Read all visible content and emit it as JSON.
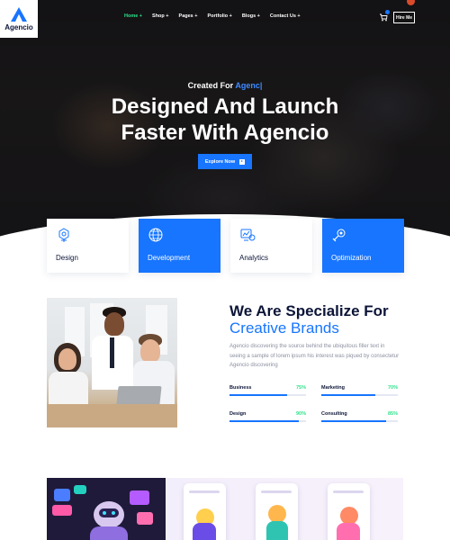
{
  "brand": {
    "name": "Agencio",
    "accent": "#1775ff",
    "nav_active": "#2ee38b"
  },
  "nav": {
    "items": [
      {
        "label": "Home +",
        "active": true
      },
      {
        "label": "Shop +",
        "active": false
      },
      {
        "label": "Pages +",
        "active": false
      },
      {
        "label": "Portfolio +",
        "active": false
      },
      {
        "label": "Blogs +",
        "active": false
      },
      {
        "label": "Contact Us +",
        "active": false
      }
    ],
    "cart_icon": "cart-icon",
    "hire_label": "Hire Me"
  },
  "hero": {
    "subtitle": "Created For ",
    "subtitle_accent": "Agenc|",
    "title_line1": "Designed And Launch",
    "title_line2": "Faster With Agencio",
    "button_label": "Explore Now",
    "button_icon": "arrow-right-icon"
  },
  "services": [
    {
      "label": "Design",
      "icon": "design-icon",
      "highlighted": false
    },
    {
      "label": "Development",
      "icon": "globe-icon",
      "highlighted": true
    },
    {
      "label": "Analytics",
      "icon": "analytics-icon",
      "highlighted": false
    },
    {
      "label": "Optimization",
      "icon": "optimization-icon",
      "highlighted": true
    }
  ],
  "about": {
    "title_line1": "We Are Specialize For",
    "title_line2": "Creative Brands",
    "description": "Agencio discovering the source behind the ubiquitous filler text in seeing a sample of lorem ipsum his interest was piqued by consectetur Agencio discovering",
    "skills": [
      {
        "name": "Business",
        "percent": "75%",
        "value": 0.75
      },
      {
        "name": "Marketing",
        "percent": "70%",
        "value": 0.7
      },
      {
        "name": "Design",
        "percent": "90%",
        "value": 0.9
      },
      {
        "name": "Consulting",
        "percent": "85%",
        "value": 0.85
      }
    ]
  }
}
